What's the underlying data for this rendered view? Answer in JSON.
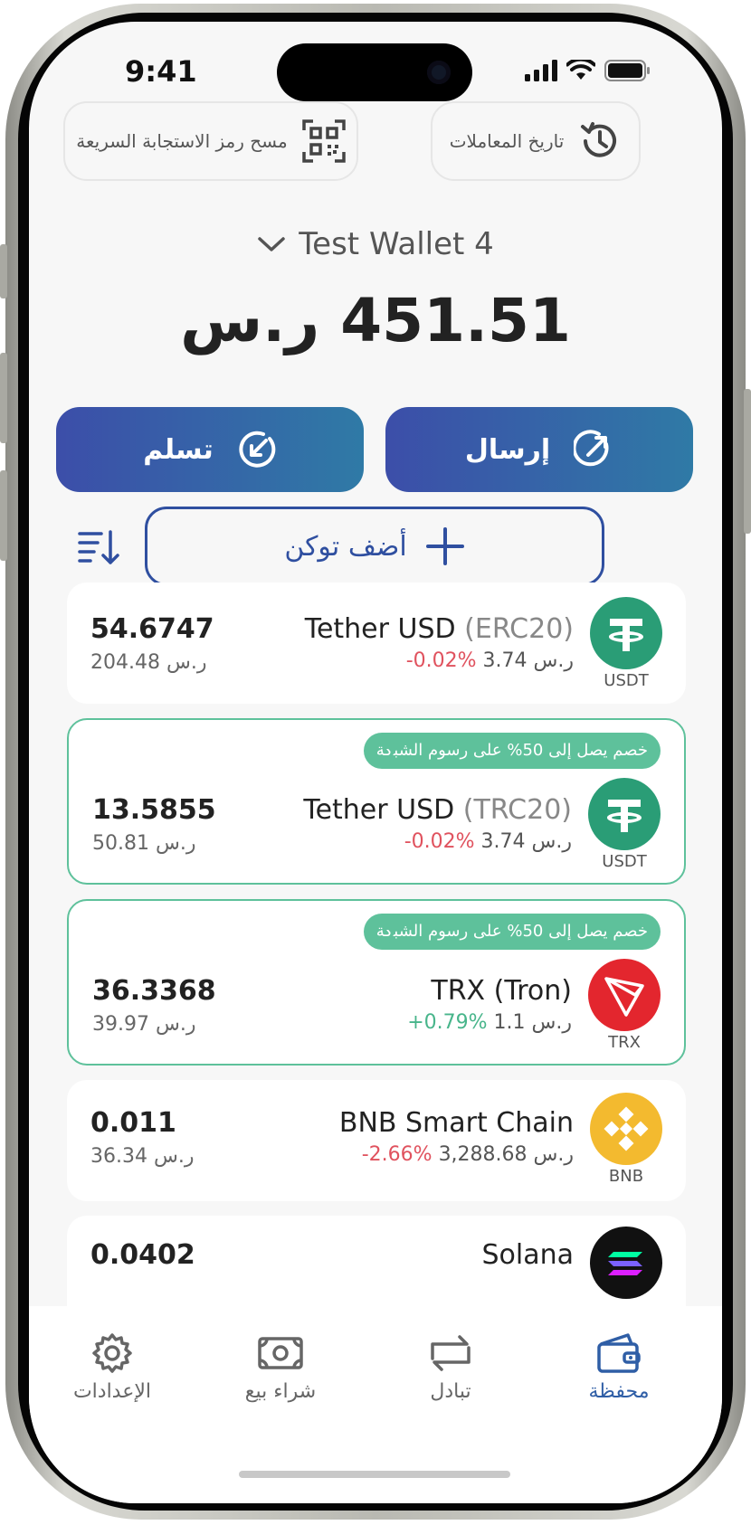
{
  "status_bar": {
    "time": "9:41"
  },
  "header": {
    "scan_label": "مسح رمز الاستجابة السريعة",
    "history_label": "تاريخ المعاملات",
    "wallet_name": "Test Wallet 4",
    "balance": "451.51 ر.س"
  },
  "actions": {
    "send_label": "إرسال",
    "receive_label": "تسلم",
    "add_token_label": "أضف توكن"
  },
  "tokens": [
    {
      "name": "Tether USD",
      "network": "(ERC20)",
      "symbol": "USDT",
      "price": "ر.س 3.74",
      "change": "-0.02%",
      "amount": "54.6747",
      "fiat": "ر.س 204.48"
    },
    {
      "badge": "خصم يصل إلى 50% على رسوم الشبكة",
      "name": "Tether USD",
      "network": "(TRC20)",
      "symbol": "USDT",
      "price": "ر.س 3.74",
      "change": "-0.02%",
      "amount": "13.5855",
      "fiat": "ر.س 50.81"
    },
    {
      "badge": "خصم يصل إلى 50% على رسوم الشبكة",
      "name": "TRX (Tron)",
      "symbol": "TRX",
      "price": "ر.س 1.1",
      "change": "+0.79%",
      "amount": "36.3368",
      "fiat": "ر.س 39.97"
    },
    {
      "name": "BNB Smart Chain",
      "symbol": "BNB",
      "price": "ر.س 3,288.68",
      "change": "-2.66%",
      "amount": "0.011",
      "fiat": "ر.س 36.34"
    },
    {
      "name": "Solana",
      "amount": "0.0402"
    }
  ],
  "tabs": [
    {
      "label": "محفظة",
      "icon": "wallet-icon"
    },
    {
      "label": "تبادل",
      "icon": "swap-icon"
    },
    {
      "label": "شراء بيع",
      "icon": "cash-icon"
    },
    {
      "label": "الإعدادات",
      "icon": "gear-icon"
    }
  ],
  "colors": {
    "accent": "#2f5ea6",
    "positive": "#48b58b",
    "negative": "#e0525e",
    "usdt": "#2a9d76",
    "trx": "#e3262e",
    "bnb": "#f3ba2f"
  }
}
